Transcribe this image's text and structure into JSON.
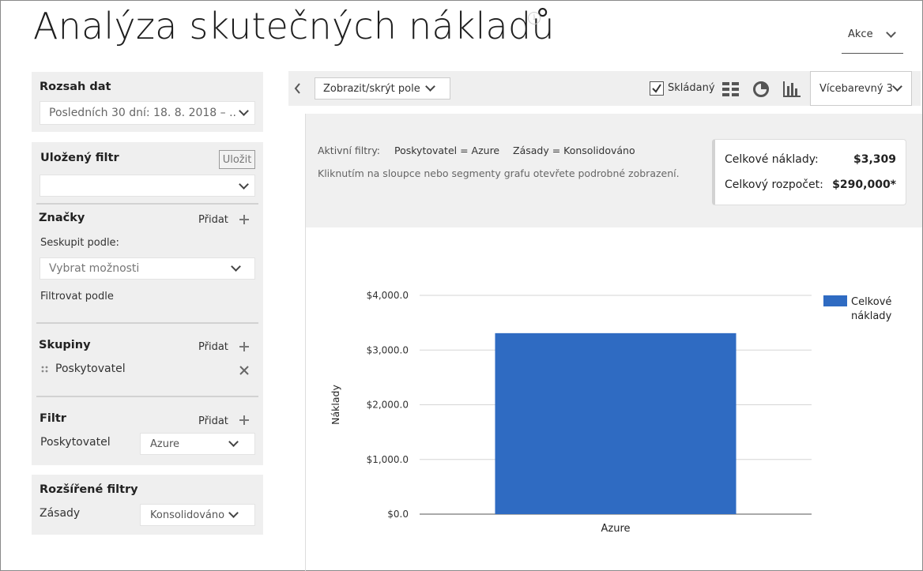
{
  "page": {
    "title": "Analýza skutečných nákladů",
    "info_icon": "info-icon"
  },
  "header": {
    "actions_label": "Akce"
  },
  "sidebar": {
    "date_range": {
      "heading": "Rozsah dat",
      "value": "Posledních 30 dní: 18. 8. 2018 – ..."
    },
    "saved_filter": {
      "heading": "Uložený filtr",
      "save_label": "Uložit",
      "value": ""
    },
    "tags": {
      "heading": "Značky",
      "add_label": "Přidat",
      "group_by_label": "Seskupit podle:",
      "group_by_placeholder": "Vybrat možnosti",
      "filter_by_label": "Filtrovat podle"
    },
    "groups": {
      "heading": "Skupiny",
      "add_label": "Přidat",
      "items": [
        {
          "label": "Poskytovatel"
        }
      ]
    },
    "filter": {
      "heading": "Filtr",
      "add_label": "Přidat",
      "field_label": "Poskytovatel",
      "field_value": "Azure"
    },
    "advanced": {
      "heading": "Rozšířené filtry",
      "field_label": "Zásady",
      "field_value": "Konsolidováno"
    }
  },
  "toolbar": {
    "show_hide_label": "Zobrazit/skrýt pole",
    "stacked_label": "Skládaný",
    "stacked_checked": true,
    "palette_label": "Vícebarevný 3"
  },
  "info": {
    "active_filters_label": "Aktivní filtry:",
    "filters": [
      "Poskytovatel = Azure",
      "Zásady = Konsolidováno"
    ],
    "hint": "Kliknutím na sloupce nebo segmenty grafu otevřete podrobné zobrazení."
  },
  "summary": {
    "total_cost_label": "Celkové náklady:",
    "total_cost_value": "$3,309",
    "total_budget_label": "Celkový rozpočet:",
    "total_budget_value": "$290,000*"
  },
  "chart_data": {
    "type": "bar",
    "categories": [
      "Azure"
    ],
    "series": [
      {
        "name": "Celkové náklady",
        "values": [
          3309
        ],
        "color": "#2f6bc2"
      }
    ],
    "ylabel": "Náklady",
    "xlabel": "",
    "ylim": [
      0,
      4000
    ],
    "yticks": [
      0,
      1000,
      2000,
      3000,
      4000
    ],
    "ytick_labels": [
      "$0.0",
      "$1,000.0",
      "$2,000.0",
      "$3,000.0",
      "$4,000.0"
    ],
    "legend": "right",
    "grid": true,
    "stacked": true
  }
}
